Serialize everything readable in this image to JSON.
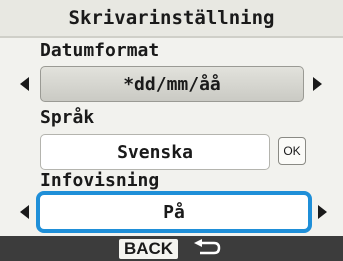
{
  "title": "Skrivarinställning",
  "settings": {
    "date_format": {
      "label": "Datumformat",
      "value": "*dd/mm/åå"
    },
    "language": {
      "label": "Språk",
      "value": "Svenska",
      "ok_label": "OK"
    },
    "info_display": {
      "label": "Infovisning",
      "value": "På"
    }
  },
  "footer": {
    "back_label": "BACK",
    "return_icon": "return-arrow-icon"
  },
  "colors": {
    "highlight": "#1f8fd8",
    "footer": "#3c3c3c",
    "background": "#f2f2ee"
  }
}
